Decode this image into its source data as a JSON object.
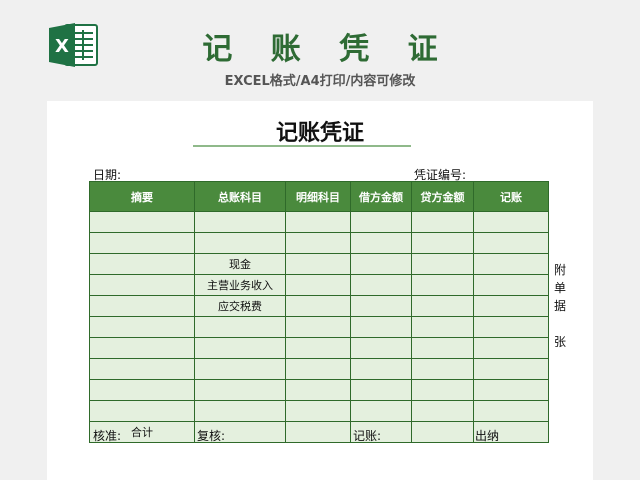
{
  "header": {
    "title": "记 账 凭 证",
    "subtitle": "EXCEL格式/A4打印/内容可修改",
    "logo_icon": "excel-icon",
    "logo_letter": "X"
  },
  "sheet": {
    "title": "记账凭证",
    "date_label": "日期:",
    "voucher_no_label": "凭证编号:",
    "columns": [
      "摘要",
      "总账科目",
      "明细科目",
      "借方金额",
      "贷方金额",
      "记账"
    ],
    "rows": [
      [
        "",
        "",
        "",
        "",
        "",
        ""
      ],
      [
        "",
        "",
        "",
        "",
        "",
        ""
      ],
      [
        "",
        "现金",
        "",
        "",
        "",
        ""
      ],
      [
        "",
        "主营业务收入",
        "",
        "",
        "",
        ""
      ],
      [
        "",
        "应交税费",
        "",
        "",
        "",
        ""
      ],
      [
        "",
        "",
        "",
        "",
        "",
        ""
      ],
      [
        "",
        "",
        "",
        "",
        "",
        ""
      ],
      [
        "",
        "",
        "",
        "",
        "",
        ""
      ],
      [
        "",
        "",
        "",
        "",
        "",
        ""
      ],
      [
        "",
        "",
        "",
        "",
        "",
        ""
      ],
      [
        "合计",
        "",
        "",
        "",
        "",
        ""
      ]
    ],
    "attachment_note": [
      "附",
      "单",
      "据",
      "张"
    ],
    "footer": {
      "approver": "核准:",
      "reviewer": "复核:",
      "bookkeeper": "记账:",
      "cashier": "出纳"
    }
  },
  "colors": {
    "brand_green": "#2e6b34",
    "header_fill": "#4a8a3d",
    "cell_fill": "#e4f0de"
  }
}
